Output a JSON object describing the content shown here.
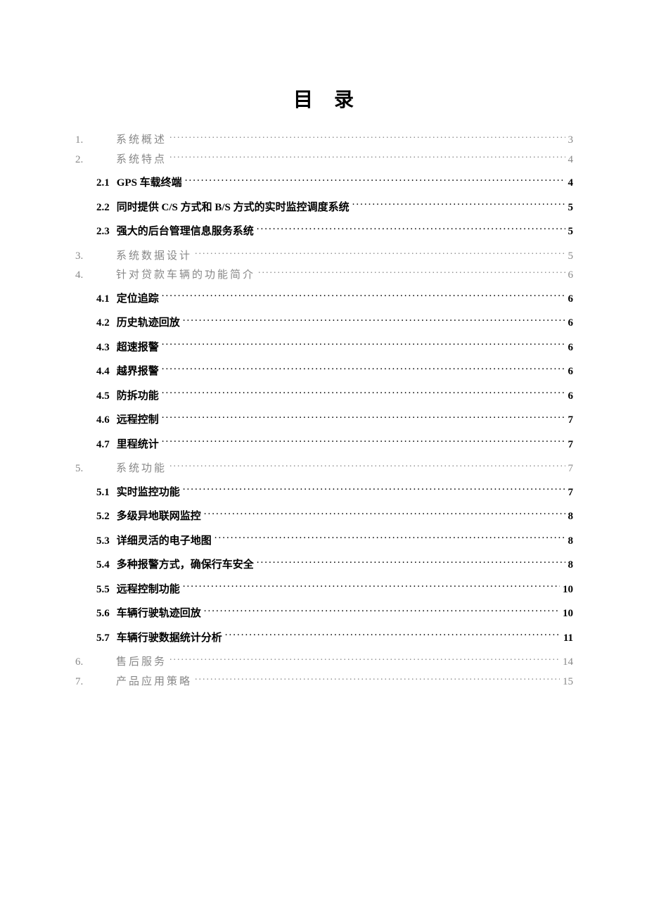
{
  "title": "目录",
  "entries": [
    {
      "level": 1,
      "number": "1.",
      "text": "系统概述",
      "page": "3",
      "afterSub": false
    },
    {
      "level": 1,
      "number": "2.",
      "text": "系统特点",
      "page": "4",
      "afterSub": false
    },
    {
      "level": 2,
      "number": "2.1",
      "text": " GPS 车载终端",
      "page": "4",
      "first": true
    },
    {
      "level": 2,
      "number": "2.2",
      "text": "同时提供 C/S 方式和 B/S 方式的实时监控调度系统",
      "page": "5"
    },
    {
      "level": 2,
      "number": "2.3",
      "text": "强大的后台管理信息服务系统",
      "page": "5"
    },
    {
      "level": 1,
      "number": "3.",
      "text": "系统数据设计",
      "page": "5",
      "afterSub": true
    },
    {
      "level": 1,
      "number": "4.",
      "text": "针对贷款车辆的功能简介",
      "page": "6",
      "afterSub": false
    },
    {
      "level": 2,
      "number": "4.1",
      "text": "定位追踪",
      "page": "6",
      "first": true
    },
    {
      "level": 2,
      "number": "4.2",
      "text": "历史轨迹回放",
      "page": "6"
    },
    {
      "level": 2,
      "number": "4.3",
      "text": "超速报警",
      "page": "6"
    },
    {
      "level": 2,
      "number": "4.4",
      "text": "越界报警",
      "page": "6"
    },
    {
      "level": 2,
      "number": "4.5",
      "text": "防拆功能",
      "page": "6"
    },
    {
      "level": 2,
      "number": "4.6",
      "text": "远程控制",
      "page": "7"
    },
    {
      "level": 2,
      "number": "4.7",
      "text": "里程统计",
      "page": "7"
    },
    {
      "level": 1,
      "number": "5.",
      "text": "系统功能",
      "page": "7",
      "afterSub": true
    },
    {
      "level": 2,
      "number": "5.1",
      "text": "实时监控功能",
      "page": "7",
      "first": true
    },
    {
      "level": 2,
      "number": "5.2",
      "text": "多级异地联网监控",
      "page": "8"
    },
    {
      "level": 2,
      "number": "5.3",
      "text": "详细灵活的电子地图",
      "page": "8"
    },
    {
      "level": 2,
      "number": "5.4",
      "text": "多种报警方式，确保行车安全",
      "page": "8"
    },
    {
      "level": 2,
      "number": "5.5",
      "text": "远程控制功能",
      "page": "10"
    },
    {
      "level": 2,
      "number": "5.6",
      "text": "车辆行驶轨迹回放",
      "page": "10"
    },
    {
      "level": 2,
      "number": "5.7",
      "text": "车辆行驶数据统计分析",
      "page": "11"
    },
    {
      "level": 1,
      "number": "6.",
      "text": "售后服务",
      "page": "14",
      "afterSub": true
    },
    {
      "level": 1,
      "number": "7.",
      "text": "产品应用策略",
      "page": "15",
      "afterSub": false
    }
  ]
}
